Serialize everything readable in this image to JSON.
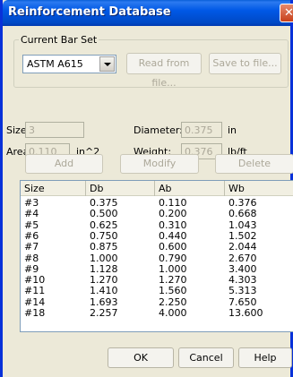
{
  "window": {
    "title": "Reinforcement Database",
    "close_symbol": "✕"
  },
  "current_bar_set": {
    "group_label": "Current Bar Set",
    "selected": "ASTM A615",
    "read_button": "Read from file...",
    "save_button": "Save to file..."
  },
  "properties": {
    "size_label": "Size:",
    "size_value": "3",
    "diameter_label": "Diameter:",
    "diameter_value": "0.375",
    "diameter_unit": "in",
    "area_label": "Area:",
    "area_value": "0.110",
    "area_unit": "in^2",
    "weight_label": "Weight:",
    "weight_value": "0.376",
    "weight_unit": "lb/ft"
  },
  "actions": {
    "add": "Add",
    "modify": "Modify",
    "delete": "Delete"
  },
  "table": {
    "headers": [
      "Size",
      "Db",
      "Ab",
      "Wb"
    ],
    "rows": [
      [
        "#3",
        "0.375",
        "0.110",
        "0.376"
      ],
      [
        "#4",
        "0.500",
        "0.200",
        "0.668"
      ],
      [
        "#5",
        "0.625",
        "0.310",
        "1.043"
      ],
      [
        "#6",
        "0.750",
        "0.440",
        "1.502"
      ],
      [
        "#7",
        "0.875",
        "0.600",
        "2.044"
      ],
      [
        "#8",
        "1.000",
        "0.790",
        "2.670"
      ],
      [
        "#9",
        "1.128",
        "1.000",
        "3.400"
      ],
      [
        "#10",
        "1.270",
        "1.270",
        "4.303"
      ],
      [
        "#11",
        "1.410",
        "1.560",
        "5.313"
      ],
      [
        "#14",
        "1.693",
        "2.250",
        "7.650"
      ],
      [
        "#18",
        "2.257",
        "4.000",
        "13.600"
      ]
    ]
  },
  "dialog": {
    "ok": "OK",
    "cancel": "Cancel",
    "help": "Help"
  }
}
